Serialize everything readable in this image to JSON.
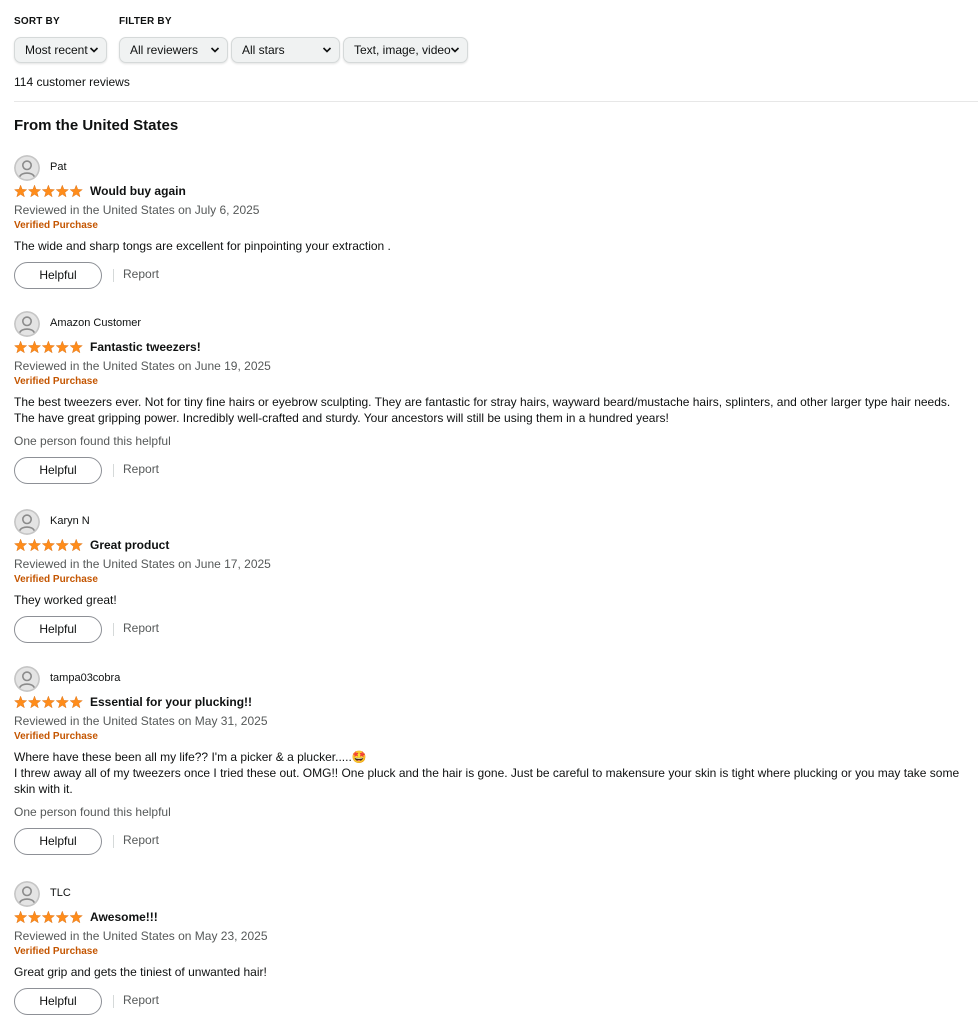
{
  "controls": {
    "sort_label": "SORT BY",
    "filter_label": "FILTER BY",
    "sort_value": "Most recent",
    "reviewer_filter": "All reviewers",
    "star_filter": "All stars",
    "format_filter": "Text, image, video"
  },
  "review_count": "114 customer reviews",
  "section_title": "From the United States",
  "rating_stars": "5 out of 5 stars",
  "helpful_label": "Helpful",
  "report_label": "Report",
  "colors": {
    "star": "#ff8c1a",
    "verified": "#c45500",
    "muted": "#565959"
  },
  "reviews": [
    {
      "name": "Pat",
      "title": "Would buy again",
      "date": "Reviewed in the United States on July 6, 2025",
      "verified": "Verified Purchase",
      "body": [
        "The wide and  sharp tongs are excellent for pinpointing your extraction ."
      ],
      "helpful": ""
    },
    {
      "name": "Amazon Customer",
      "title": "Fantastic tweezers!",
      "date": "Reviewed in the United States on June 19, 2025",
      "verified": "Verified Purchase",
      "body": [
        "The best tweezers ever. Not for tiny fine hairs or eyebrow sculpting. They are fantastic for stray hairs, wayward beard/mustache hairs, splinters, and other larger type hair needs. The have great gripping power. Incredibly well-crafted and sturdy. Your ancestors will still be using them in a hundred years!"
      ],
      "helpful": "One person found this helpful"
    },
    {
      "name": "Karyn N",
      "title": "Great product",
      "date": "Reviewed in the United States on June 17, 2025",
      "verified": "Verified Purchase",
      "body": [
        "They worked great!"
      ],
      "helpful": ""
    },
    {
      "name": "tampa03cobra",
      "title": "Essential for your plucking!!",
      "date": "Reviewed in the United States on May 31, 2025",
      "verified": "Verified Purchase",
      "body": [
        "Where have these been all my life?? I'm a picker & a plucker.....🤩",
        "I threw away all of my tweezers once I tried these out. OMG!! One pluck and the hair is gone. Just be careful to makensure your skin is tight where plucking or you may take some skin with it."
      ],
      "helpful": "One person found this helpful"
    },
    {
      "name": "TLC",
      "title": "Awesome!!!",
      "date": "Reviewed in the United States on May 23, 2025",
      "verified": "Verified Purchase",
      "body": [
        "Great grip and gets the tiniest of unwanted hair!"
      ],
      "helpful": ""
    }
  ]
}
